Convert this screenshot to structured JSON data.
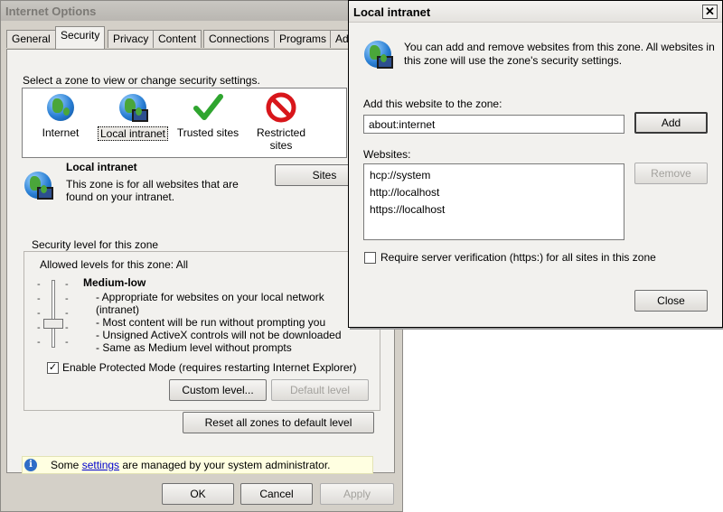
{
  "internet_options": {
    "title": "Internet Options",
    "tabs": [
      "General",
      "Security",
      "Privacy",
      "Content",
      "Connections",
      "Programs",
      "Ad"
    ],
    "select_zone_text": "Select a zone to view or change security settings.",
    "zones": [
      {
        "label": "Internet",
        "icon": "internet-globe-icon"
      },
      {
        "label": "Local intranet",
        "icon": "local-intranet-icon"
      },
      {
        "label": "Trusted sites",
        "icon": "checkmark-icon"
      },
      {
        "label": "Restricted sites",
        "icon": "restricted-icon"
      }
    ],
    "selected_zone": {
      "name": "Local intranet",
      "desc_line1": "This zone is for all websites that are",
      "desc_line2": "found on your intranet."
    },
    "sites_button": "Sites",
    "security_level": {
      "group_title": "Security level for this zone",
      "allowed_text": "Allowed levels for this zone: All",
      "level_name": "Medium-low",
      "bullets": [
        "- Appropriate for websites on your local network",
        "(intranet)",
        "- Most content will be run without prompting you",
        "- Unsigned ActiveX controls will not be downloaded",
        "- Same as Medium level without prompts"
      ],
      "protected_mode_label": "Enable Protected Mode (requires restarting Internet Explorer)",
      "protected_mode_checked": true,
      "custom_level_button": "Custom level...",
      "default_level_button": "Default level"
    },
    "reset_button": "Reset all zones to default level",
    "admin_note": {
      "before": "Some ",
      "link": "settings",
      "after": " are managed by your system administrator."
    },
    "ok_button": "OK",
    "cancel_button": "Cancel",
    "apply_button": "Apply"
  },
  "local_intranet_dialog": {
    "title": "Local intranet",
    "close_glyph": "✕",
    "info_line1": "You can add and remove websites from this zone. All websites in",
    "info_line2": "this zone will use the zone's security settings.",
    "add_label": "Add this website to the zone:",
    "add_value": "about:internet",
    "add_button": "Add",
    "websites_label": "Websites:",
    "websites": [
      "hcp://system",
      "http://localhost",
      "https://localhost"
    ],
    "remove_button": "Remove",
    "require_verification_label": "Require server verification (https:) for all sites in this zone",
    "require_verification_checked": false,
    "close_button": "Close"
  },
  "colors": {
    "window_bg": "#d4d0c8",
    "panel_bg": "#f2f1ee",
    "info_bar_bg": "#ffffe1",
    "link": "#0000cc"
  }
}
